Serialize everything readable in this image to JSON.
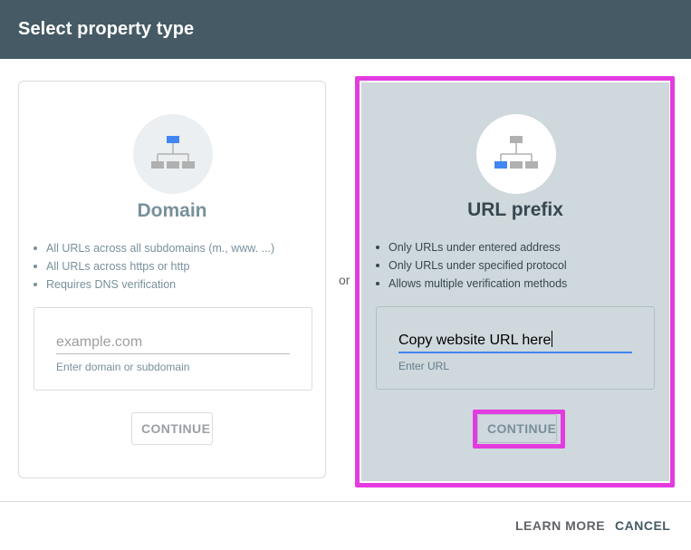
{
  "dialog": {
    "title": "Select property type"
  },
  "domain_card": {
    "title": "Domain",
    "bullets": [
      "All URLs across all subdomains (m., www. ...)",
      "All URLs across https or http",
      "Requires DNS verification"
    ],
    "input": {
      "placeholder": "example.com",
      "value": ""
    },
    "helper": "Enter domain or subdomain",
    "continue_label": "CONTINUE",
    "icon": "sitemap-top-icon"
  },
  "separator": "or",
  "url_card": {
    "title": "URL prefix",
    "bullets": [
      "Only URLs under entered address",
      "Only URLs under specified protocol",
      "Allows multiple verification methods"
    ],
    "input": {
      "value": "Copy website URL here"
    },
    "helper": "Enter URL",
    "continue_label": "CONTINUE",
    "icon": "sitemap-left-icon"
  },
  "footer": {
    "learn_more_label": "LEARN MORE",
    "cancel_label": "CANCEL"
  },
  "colors": {
    "header": "#455a64",
    "selected_card": "#cfd8dc",
    "highlight": "#e43be0",
    "icon_accent": "#4285f4",
    "icon_grey": "#b0b0b0"
  }
}
